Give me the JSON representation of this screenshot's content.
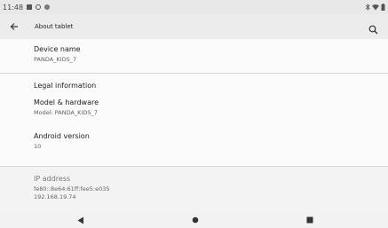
{
  "status_bar": {
    "time": "11:48",
    "right_icons": [
      "bluetooth-icon",
      "wifi-icon",
      "battery-icon"
    ]
  },
  "app_bar": {
    "title": "About tablet",
    "back_icon": "arrow-left-icon",
    "search_icon": "search-icon"
  },
  "device_name": {
    "title": "Device name",
    "value": "PANDA_KIDS_7"
  },
  "legal": {
    "title": "Legal information"
  },
  "model": {
    "title": "Model & hardware",
    "value": "Model: PANDA_KIDS_7"
  },
  "android": {
    "title": "Android version",
    "value": "10"
  },
  "ip": {
    "title": "IP address",
    "ipv6": "fe80::8e64:61ff:fee5:e035",
    "ipv4": "192.168.19.74"
  },
  "nav": {
    "back": "triangle-back-icon",
    "home": "circle-home-icon",
    "recents": "square-recents-icon"
  },
  "colors": {
    "status_bar": "#e8e8e8",
    "app_bar": "#ececec",
    "background": "#f8f8f8"
  }
}
